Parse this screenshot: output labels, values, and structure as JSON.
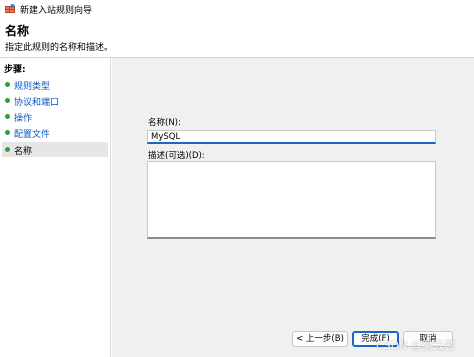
{
  "window": {
    "title": "新建入站规则向导"
  },
  "header": {
    "title": "名称",
    "subtitle": "指定此规则的名称和描述。"
  },
  "steps": {
    "heading": "步骤:",
    "items": [
      {
        "label": "规则类型"
      },
      {
        "label": "协议和端口"
      },
      {
        "label": "操作"
      },
      {
        "label": "配置文件"
      },
      {
        "label": "名称"
      }
    ]
  },
  "form": {
    "name_label": "名称(N):",
    "name_value": "MySQL",
    "description_label": "描述(可选)(D):",
    "description_value": ""
  },
  "buttons": {
    "back": "< 上一步(B)",
    "finish": "完成(F)",
    "cancel": "取消"
  },
  "watermark": "CSDN @梁云亮",
  "colors": {
    "accent": "#1a65c6",
    "step_dot": "#2ea043",
    "step_link": "#0b57c5",
    "content_bg": "#f0f0f0"
  },
  "icons": {
    "app": "firewall-icon",
    "step": "green-dot-icon"
  }
}
